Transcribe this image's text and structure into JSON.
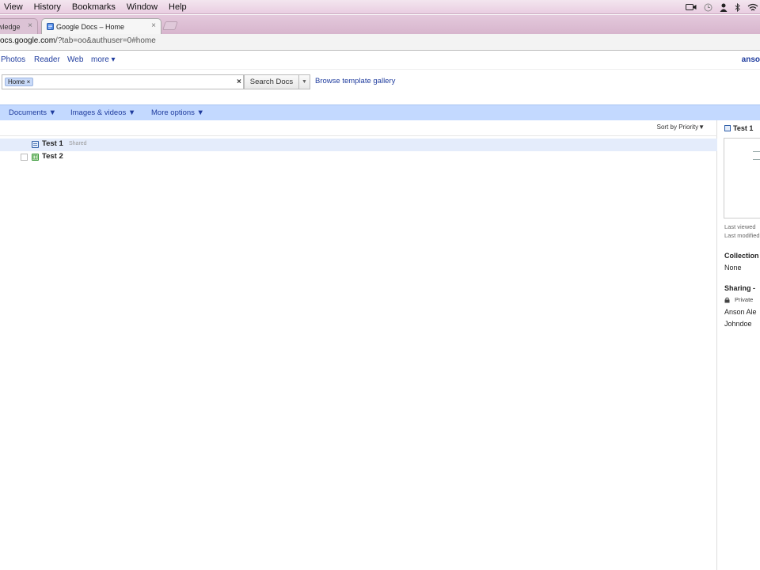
{
  "menubar": {
    "items": [
      "View",
      "History",
      "Bookmarks",
      "Window",
      "Help"
    ]
  },
  "tabs": {
    "inactive_label": "wledge",
    "active_label": "Google Docs – Home",
    "close_glyph": "×"
  },
  "address": {
    "host": "ocs.google.com",
    "path": "/?tab=oo&authuser=0#home"
  },
  "googlebar": {
    "links": [
      "Photos",
      "Reader",
      "Web",
      "more ▾"
    ],
    "user": "anso"
  },
  "search": {
    "chip_label": "Home ×",
    "clear_glyph": "×",
    "button_label": "Search Docs",
    "dropdown_glyph": "▼",
    "browse_label": "Browse template gallery"
  },
  "toolbar": {
    "items": [
      "Documents ▼",
      "Images & videos ▼",
      "More options ▼"
    ]
  },
  "list": {
    "sort_label": "Sort by Priority▼",
    "rows": [
      {
        "title": "Test 1",
        "badge": "Shared",
        "selected": true
      },
      {
        "title": "Test 2",
        "badge": "",
        "selected": false
      }
    ]
  },
  "details": {
    "title": "Test 1",
    "last_viewed": "Last viewed",
    "last_modified": "Last modified",
    "collections_heading": "Collection",
    "collections_value": "None",
    "sharing_heading": "Sharing -",
    "private_label": "Private",
    "people": [
      "Anson Ale",
      "Johndoe"
    ]
  },
  "colors": {
    "toolbar_bg": "#c3d9ff",
    "link": "#1f3c9e",
    "doc_icon": "#2e5ea8",
    "sheet_icon": "#3b9a3b"
  },
  "icons": [
    "camera-icon",
    "clock-icon",
    "user-icon",
    "bluetooth-icon",
    "wifi-icon",
    "lock-icon",
    "document-icon",
    "spreadsheet-icon"
  ]
}
